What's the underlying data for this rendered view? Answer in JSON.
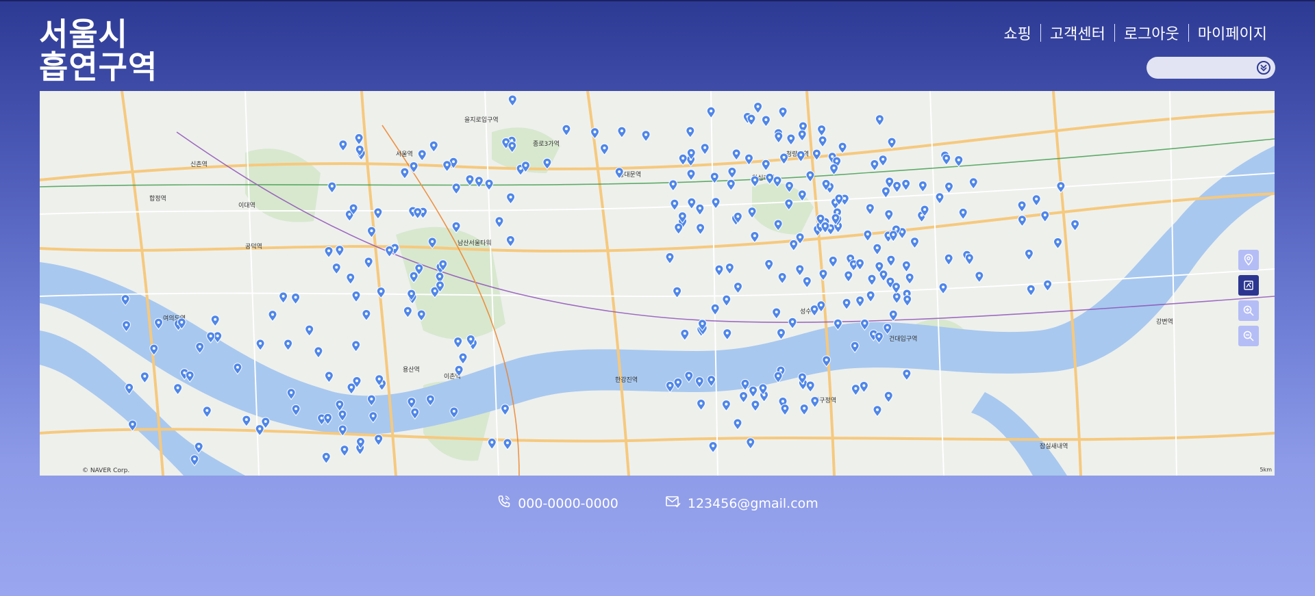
{
  "logo": {
    "line1": "서울시",
    "line2": "흡연구역"
  },
  "nav": [
    {
      "label": "쇼핑"
    },
    {
      "label": "고객센터"
    },
    {
      "label": "로그아웃"
    },
    {
      "label": "마이페이지"
    }
  ],
  "search": {
    "placeholder": "",
    "icon": "chevron-double-down-icon"
  },
  "map": {
    "attribution": "© NAVER Corp.",
    "scale_label": "5km",
    "marker_color": "#4f86e8",
    "labels": [
      "서울역",
      "을지로입구역",
      "종로3가역",
      "동대문역",
      "왕십리역",
      "청량리역",
      "성수역",
      "건대입구역",
      "강변역",
      "잠실새내역",
      "압구정역",
      "용산역",
      "이촌역",
      "한강진역",
      "여의도역",
      "신촌역",
      "합정역",
      "이대역",
      "공덕역",
      "남산서울타워"
    ],
    "controls": [
      {
        "name": "location",
        "icon": "location-pin-icon"
      },
      {
        "name": "map-type",
        "icon": "map-type-icon"
      },
      {
        "name": "zoom-in",
        "icon": "zoom-in-icon"
      },
      {
        "name": "zoom-out",
        "icon": "zoom-out-icon"
      }
    ]
  },
  "footer": {
    "phone": "000-0000-0000",
    "email": "123456@gmail.com"
  },
  "colors": {
    "bg_top": "#2d3a94",
    "bg_bottom": "#9aa6ef",
    "control_bg": "#b5bdf6",
    "control_active": "#2c3691"
  }
}
